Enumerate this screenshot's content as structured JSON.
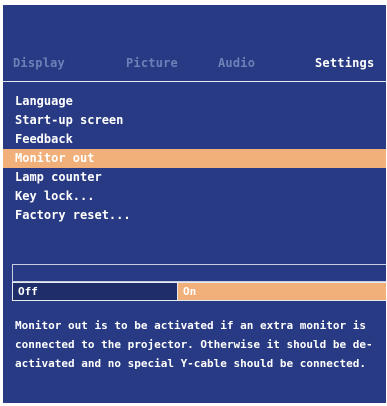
{
  "tabs": [
    {
      "label": "Display",
      "active": false
    },
    {
      "label": "Picture",
      "active": false
    },
    {
      "label": "Audio",
      "active": false
    },
    {
      "label": "Settings",
      "active": true
    }
  ],
  "menu": {
    "items": [
      {
        "label": "Language",
        "selected": false
      },
      {
        "label": "Start-up screen",
        "selected": false
      },
      {
        "label": "Feedback",
        "selected": false
      },
      {
        "label": "Monitor out",
        "selected": true
      },
      {
        "label": "Lamp counter",
        "selected": false
      },
      {
        "label": "Key lock...",
        "selected": false
      },
      {
        "label": "Factory reset...",
        "selected": false
      }
    ]
  },
  "options": {
    "off_label": "Off",
    "on_label": "On",
    "selected": "On"
  },
  "help_text": "Monitor out is to be activated if an extra monitor is connected to the projector. Otherwise it should be de-activated and no special Y-cable should be connected.",
  "colors": {
    "background": "#283a83",
    "highlight": "#f1b07a",
    "inactive_tab": "#6f7fb8",
    "off_box": "#1f2d6b"
  }
}
